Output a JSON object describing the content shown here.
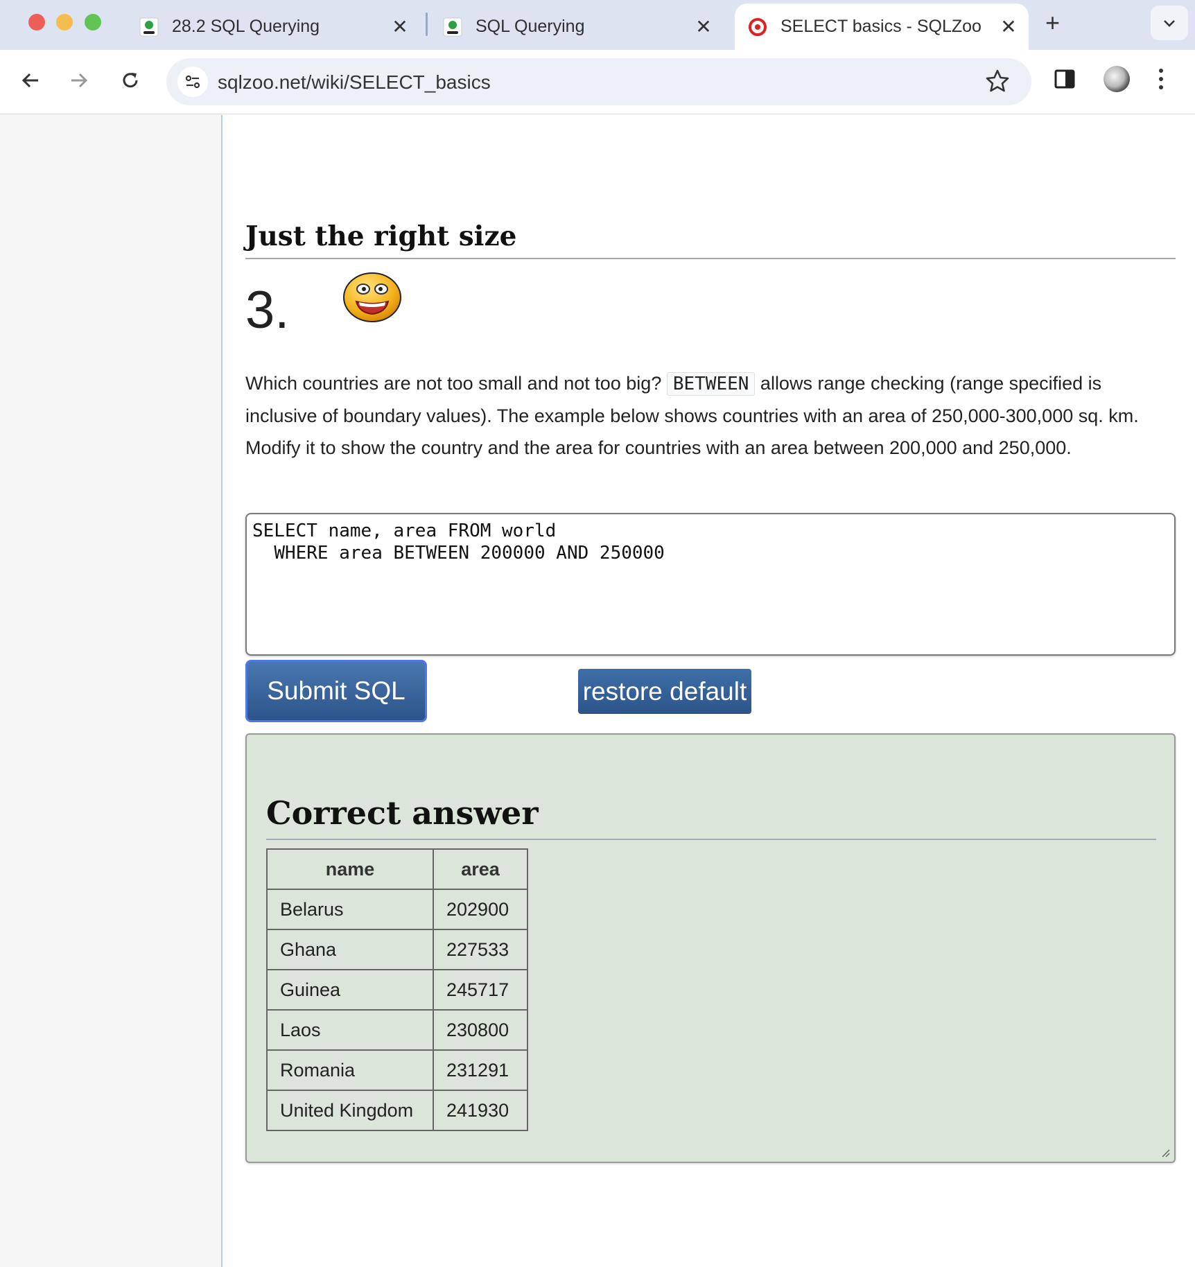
{
  "browser": {
    "tabs": [
      {
        "title": "28.2 SQL Querying",
        "favicon": "green-person-icon"
      },
      {
        "title": "SQL Querying",
        "favicon": "green-person-icon"
      },
      {
        "title": "SELECT basics - SQLZoo",
        "favicon": "sqlzoo-logo-icon",
        "active": true
      }
    ],
    "close_glyph": "✕",
    "new_tab_glyph": "+",
    "url": "sqlzoo.net/wiki/SELECT_basics"
  },
  "page": {
    "section_title": "Just the right size",
    "question_number": "3.",
    "description_part1": "Which countries are not too small and not too big? ",
    "description_code": "BETWEEN",
    "description_part2": " allows range checking (range specified is inclusive of boundary values). The example below shows countries with an area of 250,000-300,000 sq. km. Modify it to show the country and the area for countries with an area between 200,000 and 250,000.",
    "sql": "SELECT name, area FROM world\n  WHERE area BETWEEN 200000 AND 250000",
    "submit_label": "Submit SQL",
    "restore_label": "restore default",
    "answer_title": "Correct answer",
    "table": {
      "headers": [
        "name",
        "area"
      ],
      "rows": [
        {
          "name": "Belarus",
          "area": "202900"
        },
        {
          "name": "Ghana",
          "area": "227533"
        },
        {
          "name": "Guinea",
          "area": "245717"
        },
        {
          "name": "Laos",
          "area": "230800"
        },
        {
          "name": "Romania",
          "area": "231291"
        },
        {
          "name": "United Kingdom",
          "area": "241930"
        }
      ]
    }
  },
  "colors": {
    "tabstrip": "#dde3f1",
    "button": "#2c5489",
    "answer_panel": "#dce5da"
  }
}
